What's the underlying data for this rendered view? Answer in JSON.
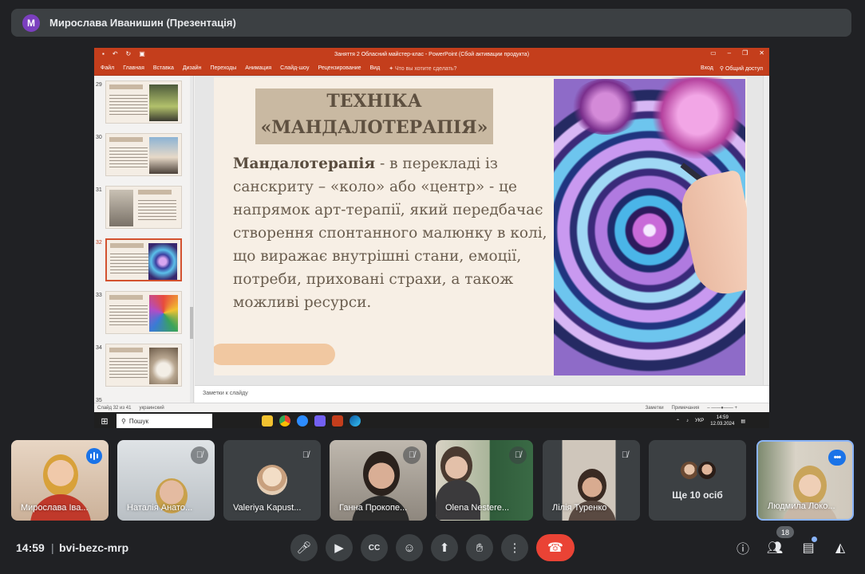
{
  "presenter_bar": {
    "avatar_letter": "M",
    "title": "Мирослава Иванишин (Презентація)"
  },
  "powerpoint": {
    "window_title": "Заняття 2 Обласний майстер-клас - PowerPoint (Сбой активации продукта)",
    "ribbon_tabs": [
      "Файл",
      "Главная",
      "Вставка",
      "Дизайн",
      "Переходы",
      "Анимация",
      "Слайд-шоу",
      "Рецензирование",
      "Вид"
    ],
    "help_search": "Что вы хотите сделать?",
    "sign_in": "Вход",
    "share": "Общий доступ",
    "thumbnail_numbers": [
      "29",
      "30",
      "31",
      "32",
      "33",
      "34",
      "35"
    ],
    "active_thumbnail": "32",
    "slide": {
      "title_line1": "ТЕХНІКА",
      "title_line2": "«МАНДАЛОТЕРАПІЯ»",
      "body_bold": "Мандалотерапія",
      "body_text": " - в перекладі із санскриту – «коло» або «центр» - це напрямок арт-терапії, який передбачає створення спонтанного малюнку в колі, що виражає внутрішні стани, емоції, потреби, приховані страхи, а також можливі ресурси."
    },
    "notes_placeholder": "Заметки к слайду",
    "status_slide": "Слайд 32 из 41",
    "status_language": "украинский",
    "status_notes": "Заметки",
    "status_comments": "Примечания",
    "taskbar_search": "Пошук",
    "tray_lang": "УКР",
    "tray_time": "14:59",
    "tray_date": "12.03.2024"
  },
  "participants": [
    {
      "name": "Мирослава Іва...",
      "speaking": true
    },
    {
      "name": "Наталія Анато...",
      "muted": true
    },
    {
      "name": "Valeriya Kapust...",
      "muted": true
    },
    {
      "name": "Ганна Прокопе...",
      "muted": true
    },
    {
      "name": "Olena Nestere...",
      "muted": true
    },
    {
      "name": "Лілія Туренко",
      "muted": true
    },
    {
      "name": "Ще 10 осіб"
    },
    {
      "name": "Людмила Локо...",
      "pinned": true
    }
  ],
  "bottom_bar": {
    "time": "14:59",
    "separator": "|",
    "meeting_code": "bvi-bezc-mrp",
    "participant_count": "18"
  },
  "colors": {
    "accent_blue": "#1a73e8",
    "end_call_red": "#ea4335",
    "ppt_orange": "#c43e1c"
  }
}
